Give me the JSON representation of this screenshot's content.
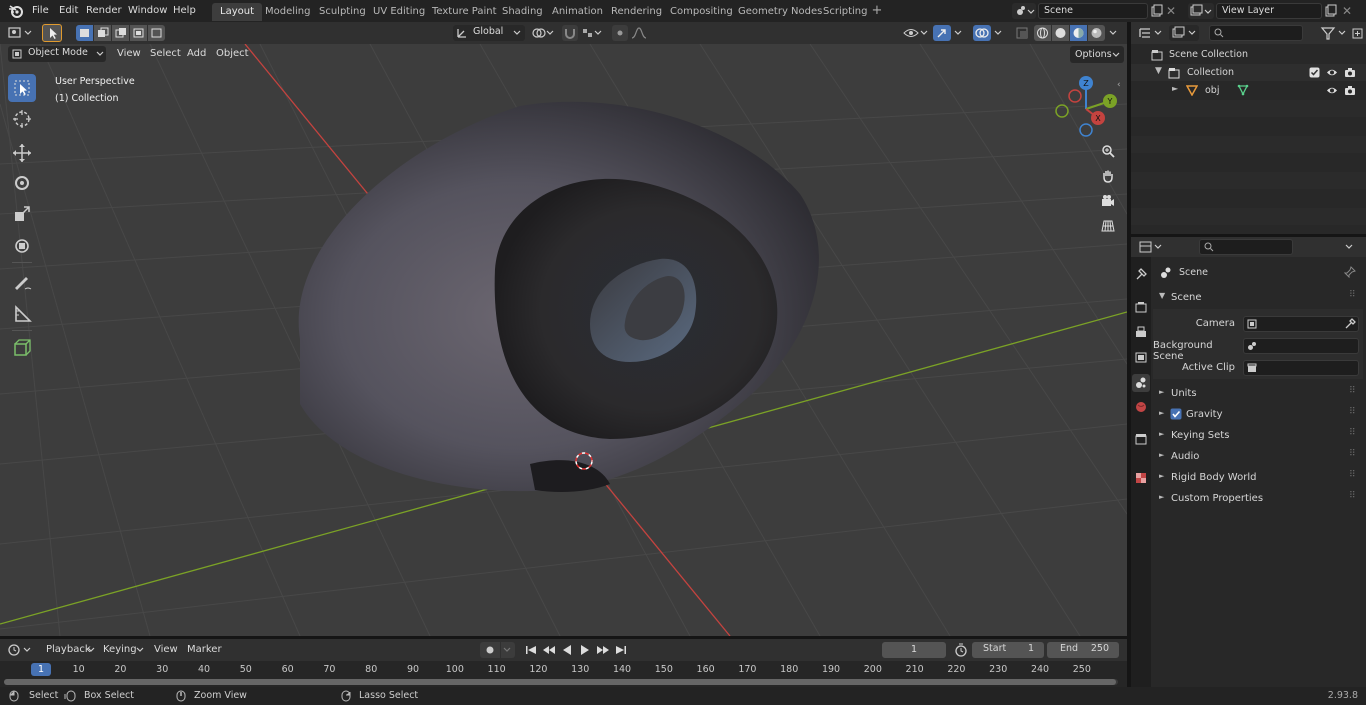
{
  "topbar": {
    "menus": [
      "File",
      "Edit",
      "Render",
      "Window",
      "Help"
    ],
    "workspaces": [
      "Layout",
      "Modeling",
      "Sculpting",
      "UV Editing",
      "Texture Paint",
      "Shading",
      "Animation",
      "Rendering",
      "Compositing",
      "Geometry Nodes",
      "Scripting"
    ],
    "active_workspace": "Layout",
    "scene_name": "Scene",
    "view_layer": "View Layer"
  },
  "viewport_header": {
    "mode": "Object Mode",
    "menus": [
      "View",
      "Select",
      "Add",
      "Object"
    ],
    "orientation": "Global",
    "options_label": "Options"
  },
  "viewport": {
    "perspective_label": "User Perspective",
    "collection_label": "(1) Collection",
    "gizmo": {
      "x": "X",
      "y": "Y",
      "z": "Z"
    }
  },
  "outliner": {
    "scene_collection": "Scene Collection",
    "collection": "Collection",
    "object": "obj"
  },
  "properties": {
    "breadcrumb": "Scene",
    "panel_title": "Scene",
    "camera_label": "Camera",
    "background_scene_label": "Background Scene",
    "active_clip_label": "Active Clip",
    "sections": [
      "Units",
      "Gravity",
      "Keying Sets",
      "Audio",
      "Rigid Body World",
      "Custom Properties"
    ],
    "gravity_checked": true
  },
  "timeline": {
    "menus": [
      "Playback",
      "Keying",
      "View",
      "Marker"
    ],
    "current_frame": "1",
    "start_label": "Start",
    "start_value": "1",
    "end_label": "End",
    "end_value": "250",
    "ruler": [
      "1",
      "10",
      "20",
      "30",
      "40",
      "50",
      "60",
      "70",
      "80",
      "90",
      "100",
      "110",
      "120",
      "130",
      "140",
      "150",
      "160",
      "170",
      "180",
      "190",
      "200",
      "210",
      "220",
      "230",
      "240",
      "250"
    ]
  },
  "statusbar": {
    "select": "Select",
    "box_select": "Box Select",
    "zoom_view": "Zoom View",
    "lasso_select": "Lasso Select",
    "version": "2.93.8"
  },
  "colors": {
    "accent": "#4772b3",
    "x_axis": "#c4433f",
    "y_axis": "#7ba226",
    "z_axis": "#3f83d0"
  }
}
